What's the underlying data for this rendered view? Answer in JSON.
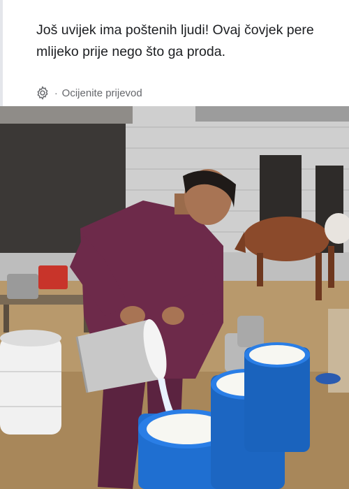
{
  "post": {
    "caption": "Još uvijek ima poštenih ljudi! Ovaj čovjek pere mlijeko prije nego što ga proda.",
    "translate_separator": "·",
    "translate_label": "Ocijenite prijevod"
  },
  "icons": {
    "translation_settings": "gear-icon"
  },
  "colors": {
    "text": "#1c1e21",
    "muted": "#65676b",
    "barrel_blue": "#1f6fd1",
    "shirt_maroon": "#6d2a4a"
  }
}
